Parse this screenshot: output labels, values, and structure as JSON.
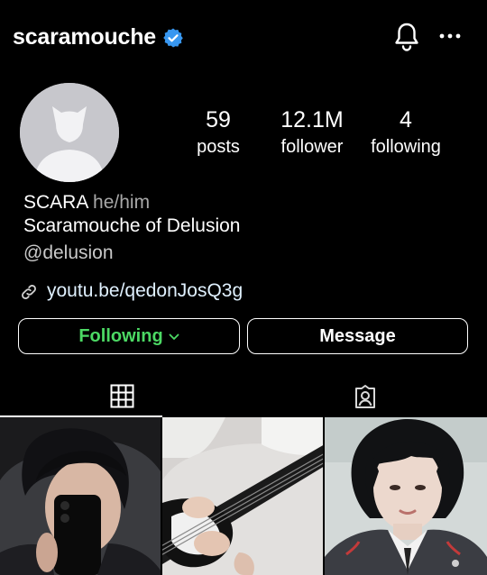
{
  "header": {
    "username": "scaramouche",
    "icons": {
      "verified": "verified-badge-icon",
      "notifications": "bell-icon",
      "menu": "more-options-icon"
    },
    "verified_color": "#3897f0"
  },
  "stats": {
    "posts": {
      "value": "59",
      "label": "posts"
    },
    "followers": {
      "value": "12.1M",
      "label": "follower"
    },
    "following": {
      "value": "4",
      "label": "following"
    }
  },
  "bio": {
    "name": "SCARA",
    "pronouns": "he/him",
    "description": "Scaramouche of Delusion",
    "handle": "@delusion",
    "link": "youtu.be/qedonJosQ3g"
  },
  "actions": {
    "following_label": "Following",
    "following_color": "#4cd964",
    "message_label": "Message"
  },
  "tabs": {
    "active": "grid",
    "icons": [
      "grid-icon",
      "tagged-icon"
    ]
  },
  "posts_grid": [
    {
      "name": "post-1",
      "alt": "mirror selfie with phone"
    },
    {
      "name": "post-2",
      "alt": "hands playing electric guitar"
    },
    {
      "name": "post-3",
      "alt": "portrait in school uniform"
    }
  ]
}
